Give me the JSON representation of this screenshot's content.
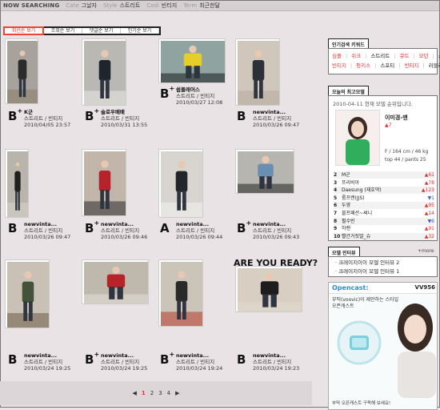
{
  "topbar": {
    "now": "NOW SEARCHING",
    "filters": [
      {
        "label": "Cate",
        "value": "그날자"
      },
      {
        "label": "Style",
        "value": "스트리트"
      },
      {
        "label": "Codi",
        "value": "빈티지"
      },
      {
        "label": "Term",
        "value": "최근한달"
      }
    ]
  },
  "tabs": [
    "최신순 보기",
    "조회순 보기",
    "댓글순 보기",
    "인기순 보기"
  ],
  "items": [
    {
      "grade": "B",
      "plus": true,
      "name": "K군",
      "style": "스트리트 / 빈티지",
      "date": "2010/04/05 23:57"
    },
    {
      "grade": "B",
      "plus": true,
      "name": "슬로우배배",
      "style": "스트리트 / 빈티지",
      "date": "2010/03/31 13:55"
    },
    {
      "grade": "B",
      "plus": true,
      "name": "쉽플래어스",
      "style": "스트리트 / 빈티지",
      "date": "2010/03/27 12:08"
    },
    {
      "grade": "B",
      "plus": false,
      "name": "newvinta...",
      "style": "스트리트 / 빈티지",
      "date": "2010/03/26 09:47"
    },
    {
      "grade": "B",
      "plus": false,
      "name": "newvinta...",
      "style": "스트리트 / 빈티지",
      "date": "2010/03/26 09:47"
    },
    {
      "grade": "B",
      "plus": true,
      "name": "newvinta...",
      "style": "스트리트 / 빈티지",
      "date": "2010/03/26 09:46"
    },
    {
      "grade": "A",
      "plus": false,
      "name": "newvinta...",
      "style": "스트리트 / 빈티지",
      "date": "2010/03/26 09:44"
    },
    {
      "grade": "B",
      "plus": true,
      "name": "newvinta...",
      "style": "스트리트 / 빈티지",
      "date": "2010/03/26 09:43"
    },
    {
      "grade": "B",
      "plus": false,
      "name": "newvinta...",
      "style": "스트리트 / 빈티지",
      "date": "2010/03/24 19:25"
    },
    {
      "grade": "B",
      "plus": true,
      "name": "newvinta...",
      "style": "스트리트 / 빈티지",
      "date": "2010/03/24 19:25"
    },
    {
      "grade": "B",
      "plus": true,
      "name": "newvinta...",
      "style": "스트리트 / 빈티지",
      "date": "2010/03/24 19:24"
    },
    {
      "grade": "B",
      "plus": false,
      "name": "newvinta...",
      "style": "스트리트 / 빈티지",
      "date": "2010/03/24 19:23",
      "caption": "ARE YOU READY?"
    }
  ],
  "popular": {
    "title": "인기검색 키워드",
    "keywords": [
      "심플",
      "쉬크",
      "스트리트",
      "큐트",
      "모던",
      "스",
      "빈티지",
      "펑키스",
      "스포티",
      "빈티지",
      "러블리"
    ]
  },
  "today": {
    "title": "오늘의 최고모델",
    "date_line": "2010-04-11  현재 모델 순위입니다.",
    "top_name": "이미경-맨",
    "top_change": "▲7",
    "stats": [
      "F / 164 cm / 46 kg",
      "top 44 / pants 25"
    ],
    "ranks": [
      {
        "no": "2",
        "name": "M군",
        "change": "▲61"
      },
      {
        "no": "3",
        "name": "프리비아",
        "change": "▲78"
      },
      {
        "no": "4",
        "name": "Daesung (재호딱)",
        "change": "▲123"
      },
      {
        "no": "5",
        "name": "룸프랜(JJS)",
        "change": "▼1"
      },
      {
        "no": "6",
        "name": "두영",
        "change": "▲95"
      },
      {
        "no": "7",
        "name": "블프패션~써니",
        "change": "▲14"
      },
      {
        "no": "8",
        "name": "펄수빈",
        "change": "▼6"
      },
      {
        "no": "9",
        "name": "하랜",
        "change": "▲91"
      },
      {
        "no": "10",
        "name": "빨간거짓말_슈",
        "change": "▲32"
      }
    ]
  },
  "interview": {
    "title": "모델 인터뷰",
    "more": "+more",
    "items": [
      "크레이지이이 모델 인터뷰 2",
      "크레이지이이 모델 인터뷰 1"
    ]
  },
  "ad": {
    "brand": "Opencast:",
    "brand_right": "VV956",
    "line1": "부띡(voovic)이 제안하는 스타일 오픈캐스트",
    "line2": "부띡 오픈캐스트 구독해 보세요!"
  },
  "pager": {
    "prev": "◀",
    "pages": [
      "1",
      "2",
      "3",
      "4"
    ],
    "next": "▶"
  },
  "colors": {
    "accent": "#e33333",
    "bg": "#e9e3e5"
  }
}
